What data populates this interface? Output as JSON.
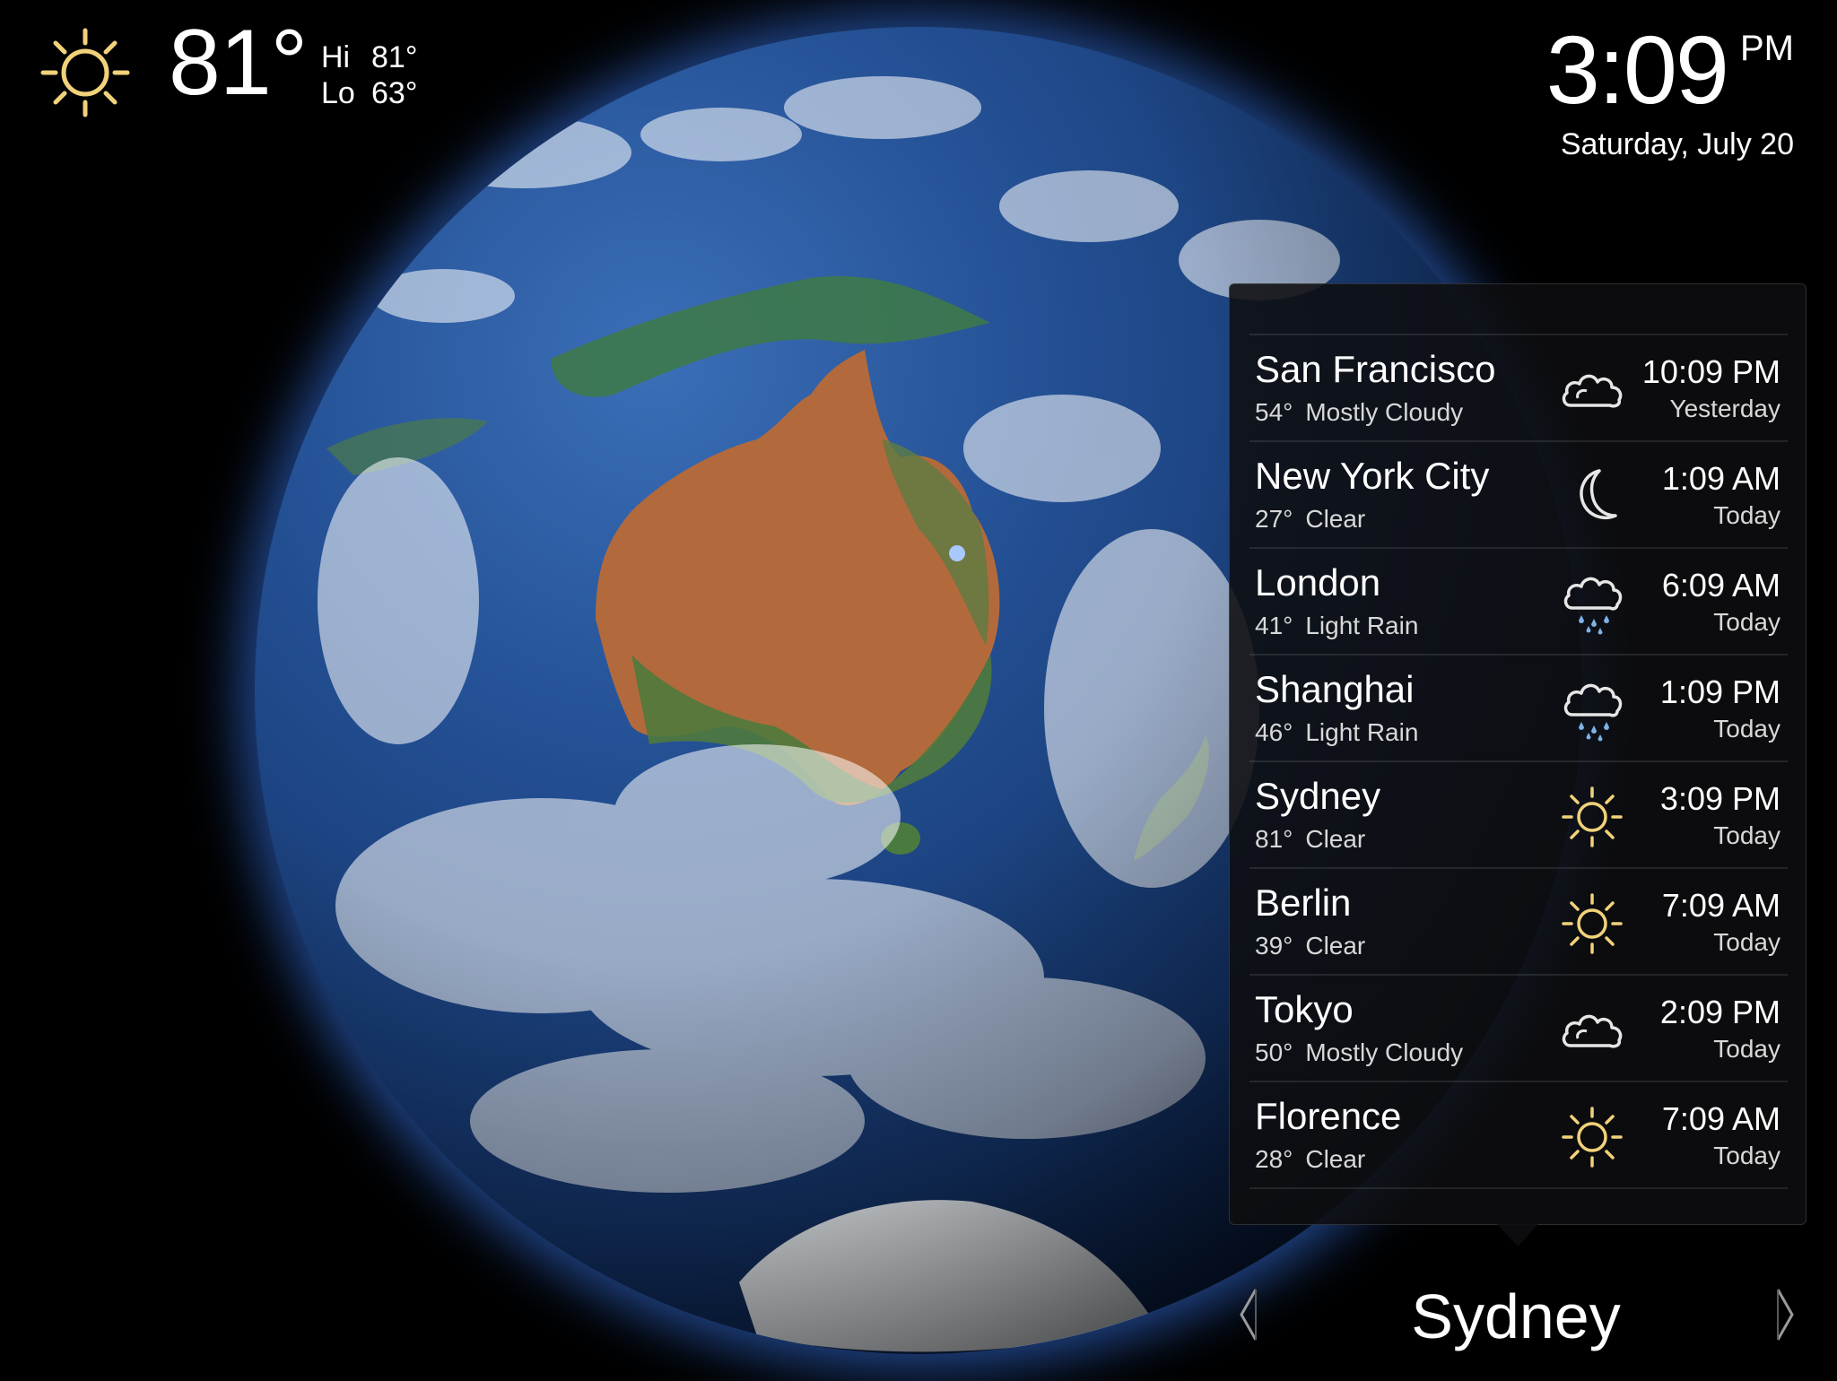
{
  "current": {
    "icon": "sun-icon",
    "temperature": "81°",
    "hi_label": "Hi",
    "hi_value": "81°",
    "lo_label": "Lo",
    "lo_value": "63°"
  },
  "clock": {
    "time": "3:09",
    "ampm": "PM",
    "date": "Saturday, July 20"
  },
  "cities": [
    {
      "name": "San Francisco",
      "temp": "54°",
      "condition": "Mostly Cloudy",
      "icon": "cloud-icon",
      "time": "10:09 PM",
      "day": "Yesterday"
    },
    {
      "name": "New York City",
      "temp": "27°",
      "condition": "Clear",
      "icon": "moon-icon",
      "time": "1:09 AM",
      "day": "Today"
    },
    {
      "name": "London",
      "temp": "41°",
      "condition": "Light Rain",
      "icon": "rain-icon",
      "time": "6:09 AM",
      "day": "Today"
    },
    {
      "name": "Shanghai",
      "temp": "46°",
      "condition": "Light Rain",
      "icon": "rain-icon",
      "time": "1:09 PM",
      "day": "Today"
    },
    {
      "name": "Sydney",
      "temp": "81°",
      "condition": "Clear",
      "icon": "sun-icon",
      "time": "3:09 PM",
      "day": "Today"
    },
    {
      "name": "Berlin",
      "temp": "39°",
      "condition": "Clear",
      "icon": "sun-icon",
      "time": "7:09 AM",
      "day": "Today"
    },
    {
      "name": "Tokyo",
      "temp": "50°",
      "condition": "Mostly Cloudy",
      "icon": "cloud-icon",
      "time": "2:09 PM",
      "day": "Today"
    },
    {
      "name": "Florence",
      "temp": "28°",
      "condition": "Clear",
      "icon": "sun-icon",
      "time": "7:09 AM",
      "day": "Today"
    }
  ],
  "selector": {
    "selected_city": "Sydney",
    "prev_icon": "chevron-left-icon",
    "next_icon": "chevron-right-icon"
  },
  "colors": {
    "sun": "#f1d27a",
    "background": "#000000",
    "globe_glow": "#3c82ff"
  }
}
